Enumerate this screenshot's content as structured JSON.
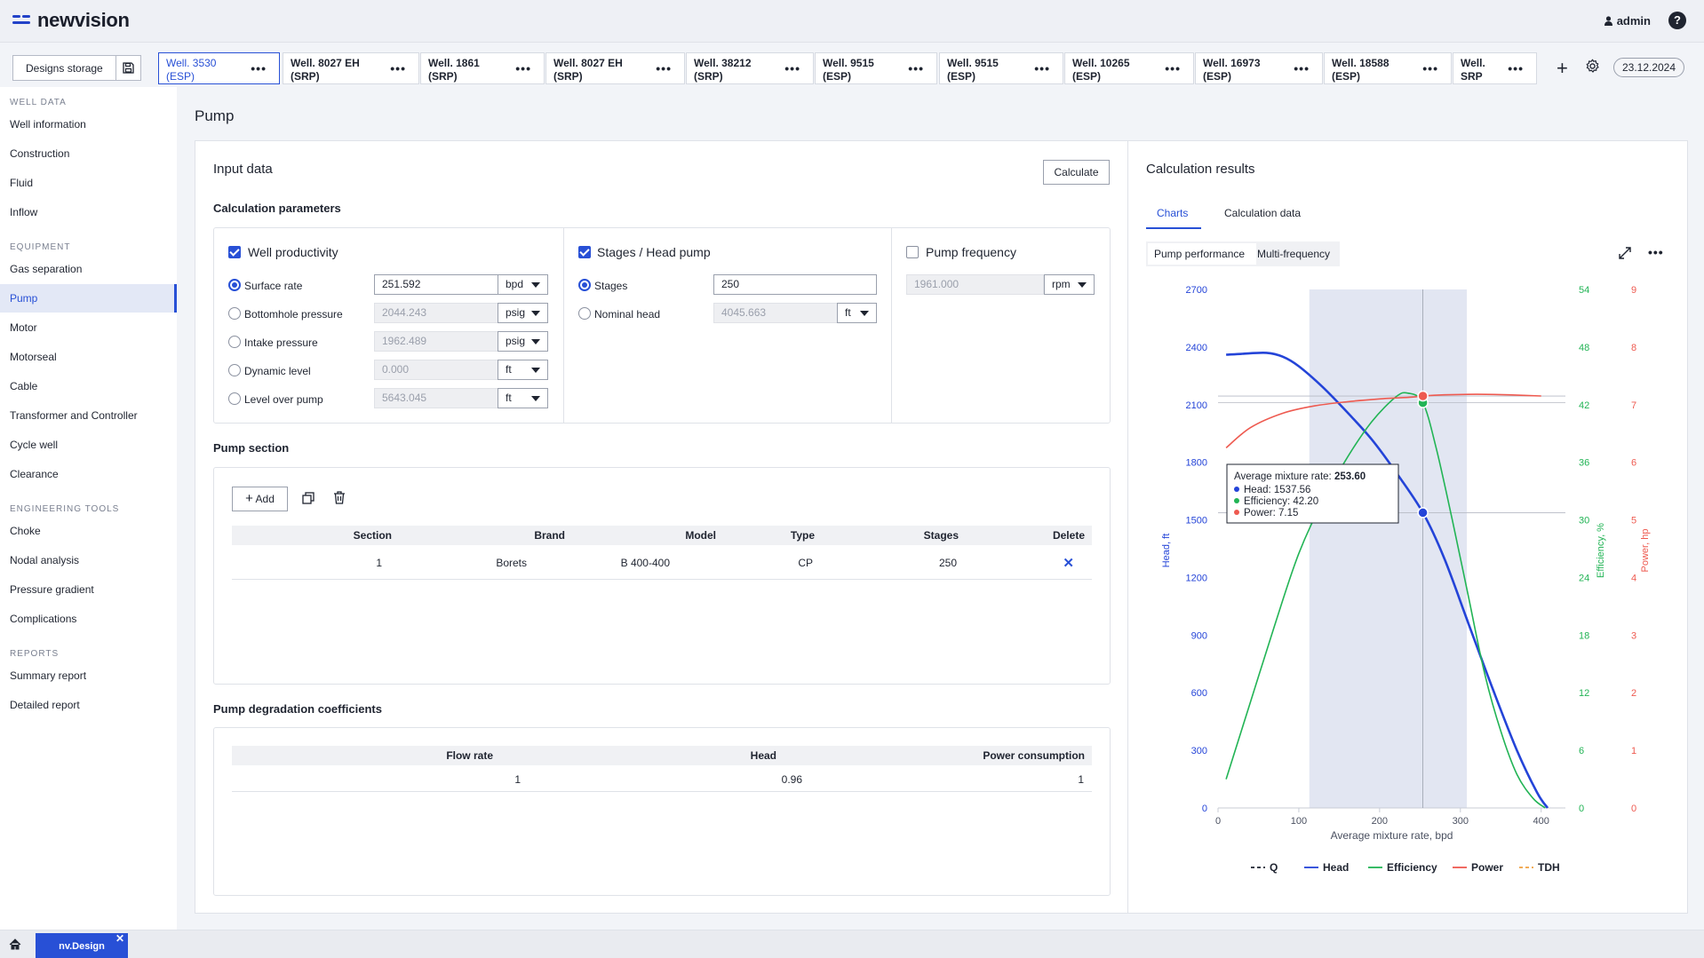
{
  "app": {
    "brand": "newvision",
    "user": "admin",
    "help": "?"
  },
  "tabs": {
    "storage_label": "Designs storage",
    "wells": [
      {
        "l1": "Well. 3530",
        "l2": "(ESP)"
      },
      {
        "l1": "Well. 8027 EH",
        "l2": "(SRP)"
      },
      {
        "l1": "Well. 1861",
        "l2": "(SRP)"
      },
      {
        "l1": "Well. 8027 EH",
        "l2": "(SRP)"
      },
      {
        "l1": "Well. 38212",
        "l2": "(SRP)"
      },
      {
        "l1": "Well. 9515",
        "l2": "(ESP)"
      },
      {
        "l1": "Well. 9515",
        "l2": "(ESP)"
      },
      {
        "l1": "Well. 10265",
        "l2": "(ESP)"
      },
      {
        "l1": "Well. 16973",
        "l2": "(ESP)"
      },
      {
        "l1": "Well. 18588",
        "l2": "(ESP)"
      },
      {
        "l1": "Well.",
        "l2": "SRP"
      }
    ],
    "dots": "•••",
    "date": "23.12.2024"
  },
  "sidebar": {
    "sections": [
      {
        "title": "WELL DATA",
        "items": [
          "Well information",
          "Construction",
          "Fluid",
          "Inflow"
        ]
      },
      {
        "title": "EQUIPMENT",
        "items": [
          "Gas separation",
          "Pump",
          "Motor",
          "Motorseal",
          "Cable",
          "Transformer and Controller",
          "Cycle well",
          "Clearance"
        ]
      },
      {
        "title": "ENGINEERING TOOLS",
        "items": [
          "Choke",
          "Nodal analysis",
          "Pressure gradient",
          "Complications"
        ]
      },
      {
        "title": "REPORTS",
        "items": [
          "Summary report",
          "Detailed report"
        ]
      }
    ],
    "active": "Pump"
  },
  "page": {
    "title": "Pump"
  },
  "input": {
    "title": "Input data",
    "calculate": "Calculate",
    "calc_params_title": "Calculation parameters",
    "well_productivity": {
      "label": "Well productivity",
      "rows": [
        {
          "label": "Surface rate",
          "value": "251.592",
          "unit": "bpd",
          "active": true
        },
        {
          "label": "Bottomhole pressure",
          "value": "2044.243",
          "unit": "psig",
          "active": false
        },
        {
          "label": "Intake pressure",
          "value": "1962.489",
          "unit": "psig",
          "active": false
        },
        {
          "label": "Dynamic level",
          "value": "0.000",
          "unit": "ft",
          "active": false
        },
        {
          "label": "Level over pump",
          "value": "5643.045",
          "unit": "ft",
          "active": false
        }
      ]
    },
    "stages_head": {
      "label": "Stages / Head pump",
      "rows": [
        {
          "label": "Stages",
          "value": "250",
          "unit": "",
          "active": true
        },
        {
          "label": "Nominal head",
          "value": "4045.663",
          "unit": "ft",
          "active": false
        }
      ]
    },
    "pump_frequency": {
      "label": "Pump frequency",
      "value": "1961.000",
      "unit": "rpm"
    },
    "pump_section": {
      "title": "Pump section",
      "add": "Add",
      "headers": [
        "Section",
        "Brand",
        "Model",
        "Type",
        "Stages",
        "Delete"
      ],
      "rows": [
        {
          "section": "1",
          "brand": "Borets",
          "model": "B 400-400",
          "type": "CP",
          "stages": "250",
          "delete": "✕"
        }
      ]
    },
    "degradation": {
      "title": "Pump degradation coefficients",
      "headers": [
        "Flow rate",
        "Head",
        "Power consumption"
      ],
      "rows": [
        {
          "flow": "1",
          "head": "0.96",
          "power": "1"
        }
      ]
    }
  },
  "results": {
    "title": "Calculation results",
    "tabs": [
      "Charts",
      "Calculation data"
    ],
    "seg": [
      "Pump performance",
      "Multi-frequency"
    ],
    "tooltip": {
      "title_label": "Average mixture rate: ",
      "title_value": "253.60",
      "lines": [
        {
          "label": "Head: ",
          "value": "1537.56"
        },
        {
          "label": "Efficiency: ",
          "value": "42.20"
        },
        {
          "label": "Power: ",
          "value": "7.15"
        }
      ]
    }
  },
  "colors": {
    "accent": "#2850d6",
    "head": "#2444d8",
    "efficiency": "#22b455",
    "power": "#ee5a50",
    "tdh": "#f0a040",
    "band": "#e2e6f2"
  },
  "chart_data": {
    "type": "line",
    "xlabel": "Average mixture rate, bpd",
    "x_ticks": [
      "0",
      "100",
      "200",
      "300",
      "400"
    ],
    "xlim": [
      0,
      430
    ],
    "axes": [
      {
        "id": "head",
        "label": "Head, ft",
        "ylim": [
          0,
          2700
        ],
        "ticks": [
          "0",
          "300",
          "600",
          "900",
          "1200",
          "1500",
          "1800",
          "2100",
          "2400",
          "2700"
        ]
      },
      {
        "id": "efficiency",
        "label": "Efficiency, %",
        "ylim": [
          0,
          54
        ],
        "ticks": [
          "0",
          "6",
          "12",
          "18",
          "24",
          "30",
          "36",
          "42",
          "48",
          "54"
        ]
      },
      {
        "id": "power",
        "label": "Power, hp",
        "ylim": [
          0,
          9
        ],
        "ticks": [
          "0",
          "1",
          "2",
          "3",
          "4",
          "5",
          "6",
          "7",
          "8",
          "9"
        ]
      }
    ],
    "operating_range": [
      113,
      308
    ],
    "operating_point": {
      "x": 253.6,
      "head": 1537.56,
      "efficiency": 42.2,
      "power": 7.15
    },
    "series": [
      {
        "name": "Q",
        "axis": "head",
        "x": [],
        "y": []
      },
      {
        "name": "Head",
        "axis": "head",
        "x": [
          10,
          30,
          60,
          80,
          100,
          130,
          160,
          190,
          220,
          253.6,
          280,
          310,
          340,
          370,
          395,
          408
        ],
        "y": [
          2360,
          2365,
          2370,
          2350,
          2300,
          2190,
          2060,
          1920,
          1750,
          1537.56,
          1300,
          960,
          620,
          300,
          80,
          0
        ]
      },
      {
        "name": "Efficiency",
        "axis": "efficiency",
        "x": [
          10,
          40,
          70,
          100,
          130,
          160,
          190,
          220,
          235,
          253.6,
          270,
          290,
          310,
          330,
          350,
          370,
          390,
          405
        ],
        "y": [
          3,
          11,
          19,
          26.5,
          32,
          36.5,
          40.2,
          42.8,
          43.2,
          42.2,
          37.5,
          30,
          22,
          14,
          8,
          3.5,
          1,
          0
        ]
      },
      {
        "name": "Power",
        "axis": "power",
        "x": [
          10,
          40,
          80,
          120,
          160,
          200,
          240,
          253.6,
          280,
          320,
          360,
          400
        ],
        "y": [
          6.25,
          6.6,
          6.85,
          6.98,
          7.05,
          7.1,
          7.13,
          7.15,
          7.17,
          7.18,
          7.17,
          7.15
        ]
      },
      {
        "name": "TDH",
        "axis": "head",
        "x": [],
        "y": []
      }
    ],
    "legend": [
      "Q",
      "Head",
      "Efficiency",
      "Power",
      "TDH"
    ]
  }
}
